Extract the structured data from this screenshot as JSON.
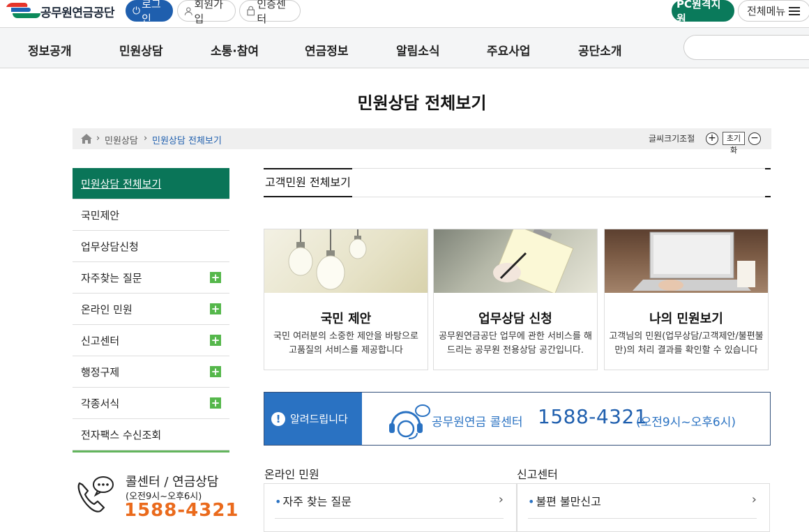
{
  "header": {
    "logo_text": "공무원연금공단",
    "login": "로그인",
    "join": "회원가입",
    "cert": "인증센터",
    "pc_support": "PC원격지원",
    "all_menu": "전체메뉴"
  },
  "gnb": [
    "정보공개",
    "민원상담",
    "소통·참여",
    "연금정보",
    "알림소식",
    "주요사업",
    "공단소개"
  ],
  "page": {
    "title": "민원상담 전체보기"
  },
  "breadcrumb": {
    "level1": "민원상담",
    "current": "민원상담 전체보기"
  },
  "font_control": {
    "label": "글씨크기조절",
    "increase": "+",
    "reset": "초기화",
    "decrease": "−"
  },
  "sidebar": {
    "items": [
      {
        "label": "민원상담 전체보기"
      },
      {
        "label": "국민제안"
      },
      {
        "label": "업무상담신청"
      },
      {
        "label": "자주찾는 질문"
      },
      {
        "label": "온라인 민원"
      },
      {
        "label": "신고센터"
      },
      {
        "label": "행정구제"
      },
      {
        "label": "각종서식"
      },
      {
        "label": "전자팩스 수신조회"
      }
    ]
  },
  "callcenter": {
    "title": "콜센터 / 연금상담",
    "hours": "(오전9시~오후6시)",
    "phone": "1588-4321"
  },
  "tab": {
    "label": "고객민원 전체보기"
  },
  "cards": [
    {
      "title": "국민 제안",
      "desc": "국민 여러분의 소중한 제안을 바탕으로 고품질의 서비스를 제공합니다"
    },
    {
      "title": "업무상담 신청",
      "desc": "공무원연금공단 업무에 관한 서비스를 해드리는 공무원 전용상담 공간입니다."
    },
    {
      "title": "나의 민원보기",
      "desc": "고객님의 민원(업무상담/고객제안/불편불만)의 처리 결과를 확인할 수 있습니다"
    }
  ],
  "notice": {
    "label": "알려드립니다",
    "center_name": "공무원연금 콜센터",
    "phone": "1588-4321",
    "hours": "(오전9시~오후6시)"
  },
  "sections": [
    {
      "title": "온라인 민원",
      "item": "자주 찾는 질문"
    },
    {
      "title": "신고센터",
      "item": "불편 불만신고"
    }
  ],
  "colors": {
    "primary_green": "#0a7558",
    "accent_blue": "#1f5fae",
    "phone_orange": "#ea6a1c"
  }
}
